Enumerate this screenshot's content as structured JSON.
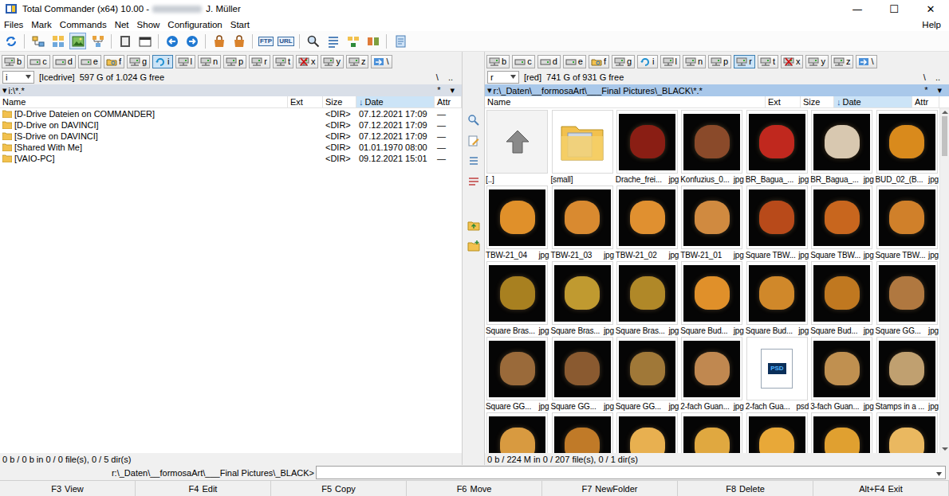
{
  "window": {
    "title": "Total Commander (x64) 10.00 - ",
    "user": "J. Müller",
    "controls": [
      "—",
      "☐",
      "✕"
    ]
  },
  "menu": [
    {
      "label": "Files"
    },
    {
      "label": "Mark"
    },
    {
      "label": "Commands"
    },
    {
      "label": "Net"
    },
    {
      "label": "Show"
    },
    {
      "label": "Configuration"
    },
    {
      "label": "Start"
    }
  ],
  "help": {
    "label": "Help"
  },
  "toolbar": {
    "icon_texts": [
      "FTP",
      "URL"
    ],
    "thumbnail_view_pressed": true
  },
  "panels": [
    {
      "active": false,
      "drives": [
        {
          "letter": "b",
          "kind": "network",
          "selected": false
        },
        {
          "letter": "c",
          "kind": "disk",
          "selected": false
        },
        {
          "letter": "d",
          "kind": "disk",
          "selected": false
        },
        {
          "letter": "e",
          "kind": "disk",
          "selected": false
        },
        {
          "letter": "f",
          "kind": "special",
          "selected": false
        },
        {
          "letter": "g",
          "kind": "network",
          "selected": false
        },
        {
          "letter": "i",
          "kind": "cloud",
          "selected": true
        },
        {
          "letter": "l",
          "kind": "network",
          "selected": false
        },
        {
          "letter": "n",
          "kind": "network",
          "selected": false
        },
        {
          "letter": "p",
          "kind": "network",
          "selected": false
        },
        {
          "letter": "r",
          "kind": "network",
          "selected": false
        },
        {
          "letter": "t",
          "kind": "network",
          "selected": false
        },
        {
          "letter": "x",
          "kind": "disconnected",
          "selected": false
        },
        {
          "letter": "y",
          "kind": "network",
          "selected": false
        },
        {
          "letter": "z",
          "kind": "network",
          "selected": false
        },
        {
          "letter": "\\",
          "kind": "root",
          "selected": false
        }
      ],
      "drive_combo": {
        "letter": "i",
        "label": "[Icedrive]",
        "free": "597 G of 1.024 G free"
      },
      "nav_buttons": [
        "\\",
        ".."
      ],
      "path_marker": "▾",
      "path": "i:\\*.*",
      "path_buttons": [
        "*",
        "▾"
      ],
      "columns": [
        {
          "label": "Name",
          "sorted": false
        },
        {
          "label": "Ext",
          "sorted": false
        },
        {
          "label": "Size",
          "sorted": false
        },
        {
          "label": "Date",
          "sorted": true,
          "sort_mark": "↓"
        },
        {
          "label": "Attr",
          "sorted": false
        }
      ],
      "rows": [
        {
          "name": "[D-Drive Dateien on COMMANDER]",
          "size": "<DIR>",
          "date": "07.12.2021 17:09",
          "attr": "—"
        },
        {
          "name": "[D-Drive on DAVINCI]",
          "size": "<DIR>",
          "date": "07.12.2021 17:09",
          "attr": "—"
        },
        {
          "name": "[S-Drive on DAVINCI]",
          "size": "<DIR>",
          "date": "07.12.2021 17:09",
          "attr": "—"
        },
        {
          "name": "[Shared With Me]",
          "size": "<DIR>",
          "date": "01.01.1970 08:00",
          "attr": "—"
        },
        {
          "name": "[VAIO-PC]",
          "size": "<DIR>",
          "date": "09.12.2021 15:01",
          "attr": "—"
        }
      ],
      "status": "0 b / 0 b in 0 / 0 file(s), 0 / 5 dir(s)"
    },
    {
      "active": true,
      "drives": [
        {
          "letter": "b",
          "kind": "network",
          "selected": false
        },
        {
          "letter": "c",
          "kind": "disk",
          "selected": false
        },
        {
          "letter": "d",
          "kind": "disk",
          "selected": false
        },
        {
          "letter": "e",
          "kind": "disk",
          "selected": false
        },
        {
          "letter": "f",
          "kind": "special",
          "selected": false
        },
        {
          "letter": "g",
          "kind": "network",
          "selected": false
        },
        {
          "letter": "i",
          "kind": "cloud",
          "selected": false
        },
        {
          "letter": "l",
          "kind": "network",
          "selected": false
        },
        {
          "letter": "n",
          "kind": "network",
          "selected": false
        },
        {
          "letter": "p",
          "kind": "network",
          "selected": false
        },
        {
          "letter": "r",
          "kind": "network",
          "selected": true
        },
        {
          "letter": "t",
          "kind": "network",
          "selected": false
        },
        {
          "letter": "x",
          "kind": "disconnected",
          "selected": false
        },
        {
          "letter": "y",
          "kind": "network",
          "selected": false
        },
        {
          "letter": "z",
          "kind": "network",
          "selected": false
        },
        {
          "letter": "\\",
          "kind": "root",
          "selected": false
        }
      ],
      "drive_combo": {
        "letter": "r",
        "label": "[red]",
        "free": "741 G of 931 G free"
      },
      "nav_buttons": [
        "\\",
        ".."
      ],
      "path_marker": "▾",
      "path": "r:\\_Daten\\__formosaArt\\___Final Pictures\\_BLACK\\*.*",
      "path_buttons": [
        "*",
        "▾"
      ],
      "columns": [
        {
          "label": "Name",
          "sorted": false
        },
        {
          "label": "Ext",
          "sorted": false
        },
        {
          "label": "Size",
          "sorted": false
        },
        {
          "label": "Date",
          "sorted": true,
          "sort_mark": "↓"
        },
        {
          "label": "Attr",
          "sorted": false
        }
      ],
      "thumbnails": [
        {
          "kind": "parent",
          "name": "[..]"
        },
        {
          "kind": "folder",
          "name": "[small]"
        },
        {
          "kind": "photo",
          "name": "Drache_frei...",
          "ext": "jpg",
          "color": "#8a1e14"
        },
        {
          "kind": "photo",
          "name": "Konfuzius_0...",
          "ext": "jpg",
          "color": "#8a4a2a"
        },
        {
          "kind": "photo",
          "name": "BR_Bagua_...",
          "ext": "jpg",
          "color": "#c0281e"
        },
        {
          "kind": "photo",
          "name": "BR_Bagua_...",
          "ext": "jpg",
          "color": "#d8c8b0"
        },
        {
          "kind": "photo",
          "name": "BUD_02_(B...",
          "ext": "jpg",
          "color": "#d98a1c"
        },
        {
          "kind": "photo",
          "name": "TBW-21_04",
          "ext": "jpg",
          "color": "#e0902a"
        },
        {
          "kind": "photo",
          "name": "TBW-21_03",
          "ext": "jpg",
          "color": "#d98a30"
        },
        {
          "kind": "photo",
          "name": "TBW-21_02",
          "ext": "jpg",
          "color": "#e09030"
        },
        {
          "kind": "photo",
          "name": "TBW-21_01",
          "ext": "jpg",
          "color": "#d08a40"
        },
        {
          "kind": "photo",
          "name": "Square TBW...",
          "ext": "jpg",
          "color": "#b84a1a"
        },
        {
          "kind": "photo",
          "name": "Square TBW...",
          "ext": "jpg",
          "color": "#c8661e"
        },
        {
          "kind": "photo",
          "name": "Square TBW...",
          "ext": "jpg",
          "color": "#d0802a"
        },
        {
          "kind": "photo",
          "name": "Square Bras...",
          "ext": "jpg",
          "color": "#a88020"
        },
        {
          "kind": "photo",
          "name": "Square Bras...",
          "ext": "jpg",
          "color": "#c09a30"
        },
        {
          "kind": "photo",
          "name": "Square Bras...",
          "ext": "jpg",
          "color": "#b08828"
        },
        {
          "kind": "photo",
          "name": "Square Bud...",
          "ext": "jpg",
          "color": "#e0902a"
        },
        {
          "kind": "photo",
          "name": "Square Bud...",
          "ext": "jpg",
          "color": "#d0882a"
        },
        {
          "kind": "photo",
          "name": "Square Bud...",
          "ext": "jpg",
          "color": "#c07820"
        },
        {
          "kind": "photo",
          "name": "Square GG...",
          "ext": "jpg",
          "color": "#b07840"
        },
        {
          "kind": "photo",
          "name": "Square GG...",
          "ext": "jpg",
          "color": "#9a6a3a"
        },
        {
          "kind": "photo",
          "name": "Square GG...",
          "ext": "jpg",
          "color": "#8a5a30"
        },
        {
          "kind": "photo",
          "name": "Square GG...",
          "ext": "jpg",
          "color": "#a07838"
        },
        {
          "kind": "photo",
          "name": "2-fach Guan...",
          "ext": "jpg",
          "color": "#c08850"
        },
        {
          "kind": "psd",
          "name": "2-fach Gua...",
          "ext": "psd",
          "icon_text": "PSD"
        },
        {
          "kind": "photo",
          "name": "3-fach Guan...",
          "ext": "jpg",
          "color": "#c09050"
        },
        {
          "kind": "photo",
          "name": "Stamps in a ...",
          "ext": "jpg",
          "color": "#c0a070"
        },
        {
          "kind": "photo",
          "color": "#d89a40"
        },
        {
          "kind": "photo",
          "color": "#c07a28"
        },
        {
          "kind": "photo",
          "color": "#e8b050"
        },
        {
          "kind": "photo",
          "color": "#e0a840"
        },
        {
          "kind": "photo",
          "color": "#e8a838"
        },
        {
          "kind": "photo",
          "color": "#e0a030"
        },
        {
          "kind": "photo",
          "color": "#eab860"
        }
      ],
      "scrollbar": {
        "level": 0.12
      },
      "status": "0 b / 224 M in 0 / 207 file(s), 0 / 1 dir(s)"
    }
  ],
  "command_line": {
    "prompt": "r:\\_Daten\\__formosaArt\\___Final Pictures\\_BLACK>",
    "value": ""
  },
  "function_keys": [
    {
      "key": "F3",
      "label": "View"
    },
    {
      "key": "F4",
      "label": "Edit"
    },
    {
      "key": "F5",
      "label": "Copy"
    },
    {
      "key": "F6",
      "label": "Move"
    },
    {
      "key": "F7",
      "label": "NewFolder"
    },
    {
      "key": "F8",
      "label": "Delete"
    },
    {
      "key": "Alt+F4",
      "label": "Exit"
    }
  ]
}
